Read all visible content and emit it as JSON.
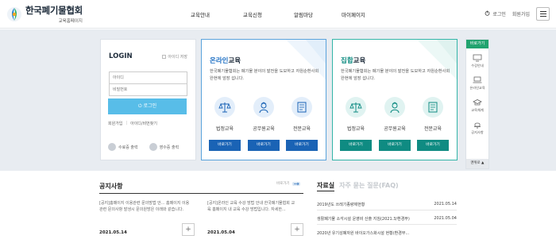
{
  "header": {
    "logo_title": "한국폐기물협회",
    "logo_sub": "교육홈페이지",
    "nav": [
      "교육안내",
      "교육신청",
      "알림마당",
      "마이페이지"
    ],
    "login_label": "로그인",
    "join_label": "회원가입"
  },
  "login": {
    "title": "LOGIN",
    "save_id": "아이디 저장",
    "id_placeholder": "아이디",
    "pw_placeholder": "비밀번호",
    "button": "로그인",
    "join": "회원가입",
    "find": "아이디/비번찾기",
    "receipt": "수료증 출력",
    "bill": "영수증 출력"
  },
  "online": {
    "title_hl": "온라인",
    "title_rest": "교육",
    "desc": "한국폐기물협회는 폐기물 분야의 발전을 도모하고 자원순환사회 완현에 앞장 섭니다.",
    "items": [
      {
        "label": "법정교육",
        "button": "바로가기"
      },
      {
        "label": "공무원교육",
        "button": "바로가기"
      },
      {
        "label": "전문교육",
        "button": "바로가기"
      }
    ]
  },
  "group": {
    "title_hl": "집합",
    "title_rest": "교육",
    "desc": "한국폐기물협회는 폐기물 분야의 발전을 도모하고 자원순환사회 완현에 앞장 섭니다.",
    "items": [
      {
        "label": "법정교육",
        "button": "바로가기"
      },
      {
        "label": "공무원교육",
        "button": "바로가기"
      },
      {
        "label": "전문교육",
        "button": "바로가기"
      }
    ]
  },
  "quick": {
    "title": "바로가기",
    "items": [
      "수강안내",
      "온라인교육",
      "교육체계",
      "공지사항"
    ],
    "top": "맨위로 ▲"
  },
  "notice": {
    "title": "공지사항",
    "more": "바로가기",
    "items": [
      {
        "text": "[공지]홈페이지 이용관련 문의방법 안... 홈페이지 이용관련 문의사항 발생시 문의원방은 이래와 같습니다.",
        "date": "2021.05.14"
      },
      {
        "text": "[공지]온라인 교육 수강 방법 안내 한국폐기물협회 교육 홈페이지 내 교육 수강 방법입니다. 자세한...",
        "date": "2021.05.04"
      }
    ]
  },
  "faq": {
    "tab_active": "자료실",
    "tab_inactive": "자주 묻는 질문(FAQ)",
    "items": [
      {
        "text": "2019년도 쓰레기종량제현황",
        "date": "2021.05.14"
      },
      {
        "text": "생활폐기물 소각시설 운영비 산출 지침(2021.3/환경부)",
        "date": "2021.05.04"
      },
      {
        "text": "2020년 유기성폐자원 바이오가스화시설 현황(환경부...",
        "date": ""
      }
    ]
  },
  "colors": {
    "online_accent": "#1a63b5",
    "group_accent": "#0f8b82",
    "login_button": "#58bde8",
    "quick_head": "#22a36f"
  }
}
